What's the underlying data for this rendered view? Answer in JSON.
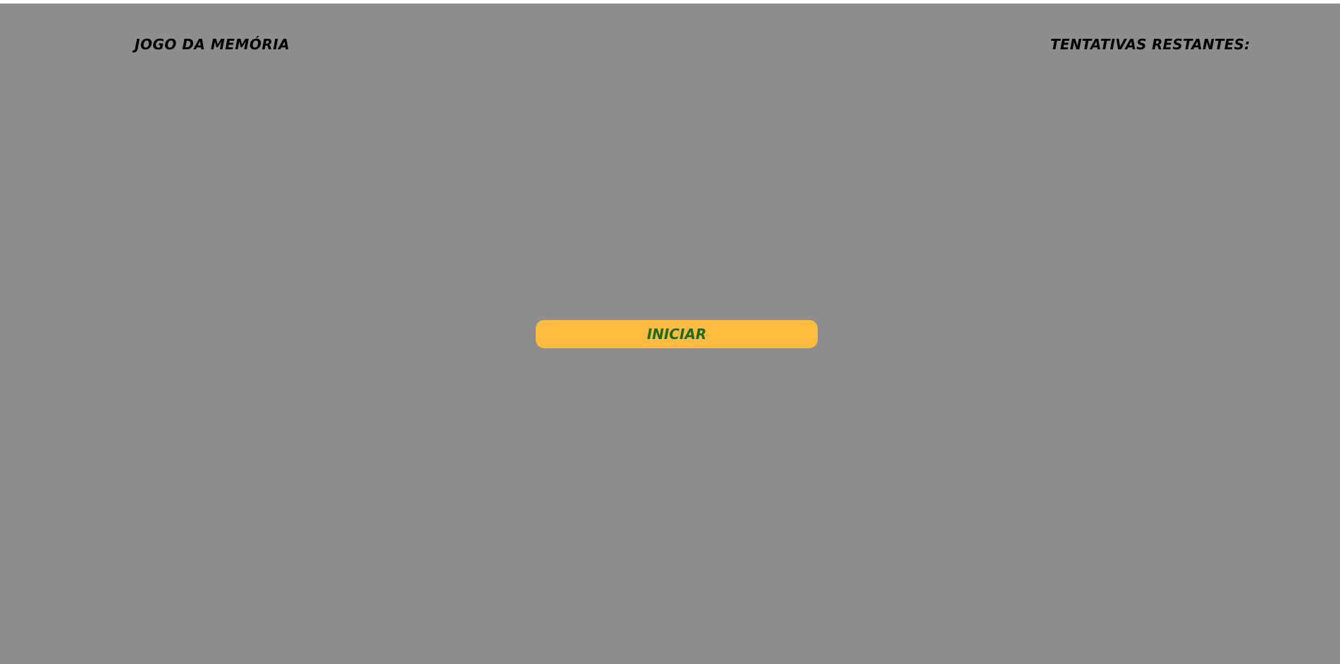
{
  "header": {
    "title": "JOGO DA MEMÓRIA",
    "attempts_label": "TENTATIVAS RESTANTES:",
    "attempts_value": ""
  },
  "main": {
    "start_label": "INICIAR"
  },
  "colors": {
    "page_background": "#8e8e8e",
    "button_background": "#ffbb40",
    "button_text": "#1e6b1e",
    "header_text": "#000000"
  }
}
